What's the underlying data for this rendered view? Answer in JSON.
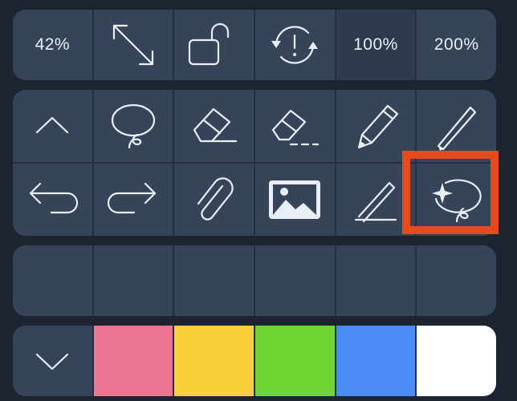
{
  "top_bar": {
    "zoom_level": "42%",
    "fullscreen_icon": "expand-arrows-icon",
    "lock_icon": "unlock-icon",
    "rotate_icon": "rotate-alert-icon",
    "zoom_100_label": "100%",
    "zoom_200_label": "200%"
  },
  "tools_row1": [
    {
      "icon": "chevron-up-icon"
    },
    {
      "icon": "lasso-icon"
    },
    {
      "icon": "eraser-icon"
    },
    {
      "icon": "eraser-line-icon"
    },
    {
      "icon": "pencil-icon"
    },
    {
      "icon": "pen-icon"
    }
  ],
  "tools_row2": [
    {
      "icon": "undo-icon"
    },
    {
      "icon": "redo-icon"
    },
    {
      "icon": "paperclip-icon"
    },
    {
      "icon": "image-icon"
    },
    {
      "icon": "ruler-pen-icon"
    },
    {
      "icon": "ai-lasso-icon",
      "selected": true
    }
  ],
  "colors": {
    "swatches": [
      "#ec7594",
      "#fbcf3a",
      "#6fd532",
      "#4a8bf5",
      "#ffffff"
    ],
    "accent_highlight": "#e8491d"
  },
  "collapse_icon": "chevron-down-icon"
}
